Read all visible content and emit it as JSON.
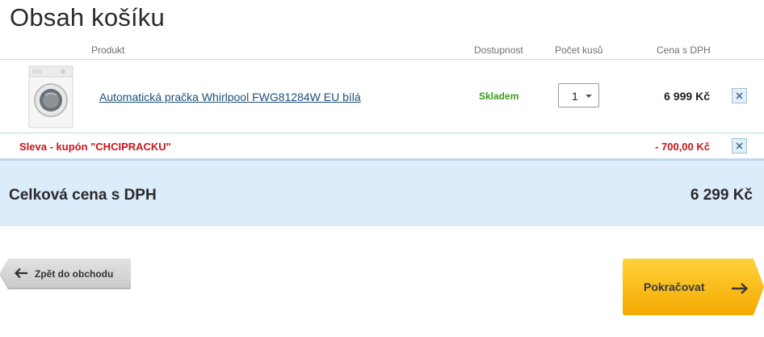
{
  "page": {
    "title": "Obsah košíku"
  },
  "table_headers": {
    "product": "Produkt",
    "availability": "Dostupnost",
    "quantity": "Počet kusů",
    "price": "Cena s DPH"
  },
  "items": [
    {
      "name": "Automatická pračka Whirlpool FWG81284W EU bílá",
      "availability": "Skladem",
      "quantity": "1",
      "price": "6 999 Kč",
      "thumbnail_icon": "washing-machine-icon"
    }
  ],
  "discount": {
    "label": "Sleva - kupón \"CHCIPRACKU\"",
    "value": "- 700,00 Kč"
  },
  "total": {
    "label": "Celková cena s DPH",
    "value": "6 299 Kč"
  },
  "buttons": {
    "back": "Zpět do obchodu",
    "continue": "Pokračovat"
  },
  "colors": {
    "link": "#1c4f79",
    "in_stock": "#3c9b1e",
    "discount": "#c8141b",
    "total_bg": "#dcecfa",
    "continue_bg": "#f7b500",
    "back_bg": "#d6d6d6"
  }
}
